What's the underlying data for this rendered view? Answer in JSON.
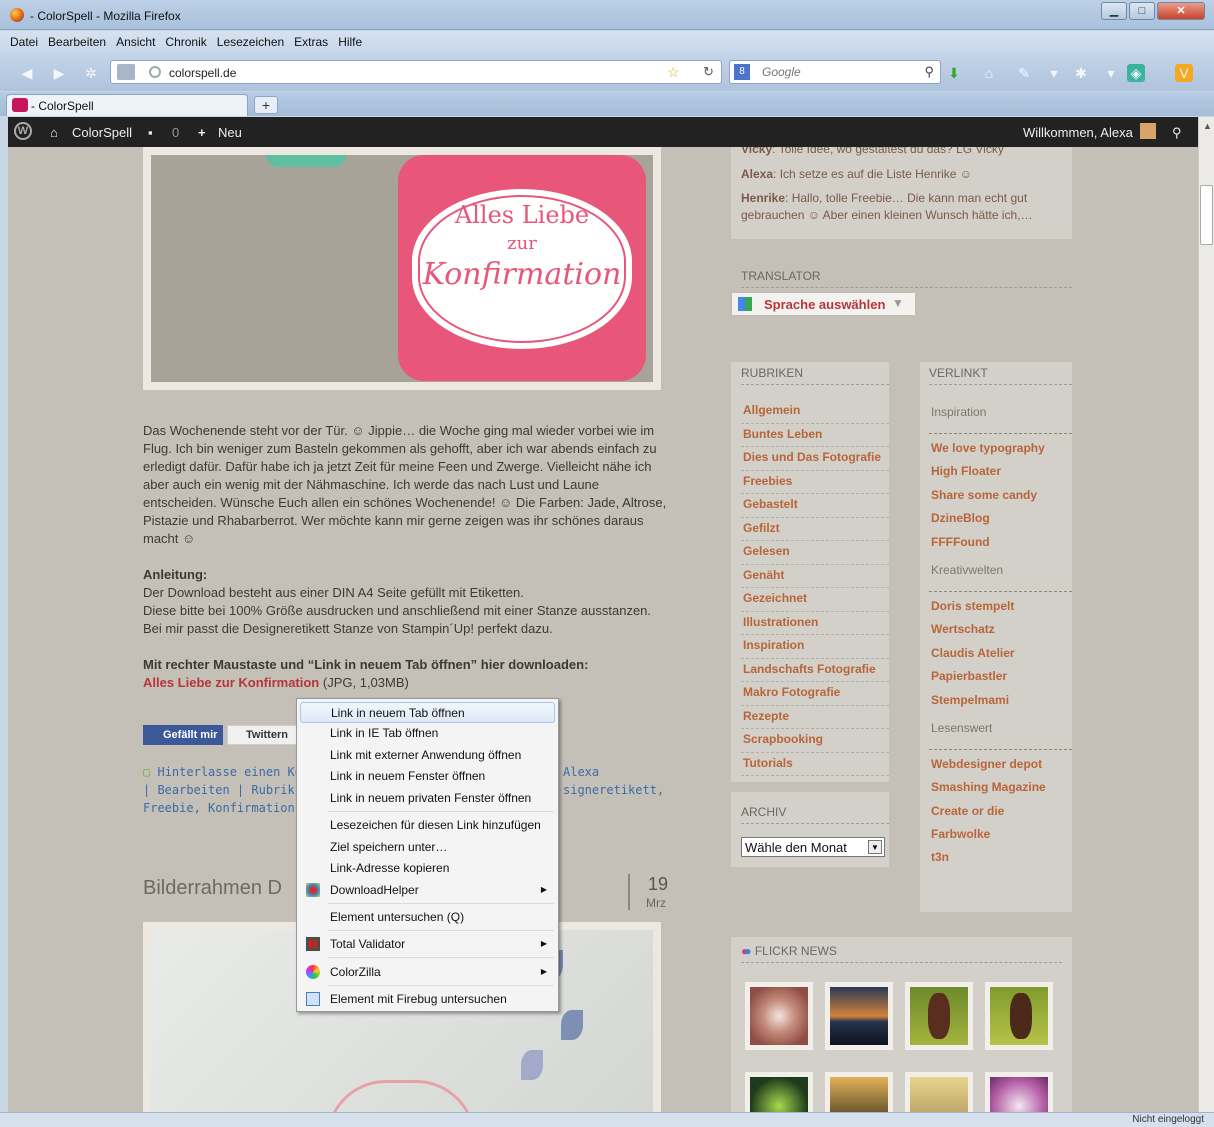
{
  "window": {
    "title": "- ColorSpell - Mozilla Firefox"
  },
  "menu": [
    "Datei",
    "Bearbeiten",
    "Ansicht",
    "Chronik",
    "Lesezeichen",
    "Extras",
    "Hilfe"
  ],
  "nav": {
    "url": "colorspell.de",
    "search_placeholder": "Google"
  },
  "tab": {
    "title": "- ColorSpell",
    "new": "+"
  },
  "admin": {
    "site": "ColorSpell",
    "comments": "0",
    "new": "Neu",
    "welcome": "Willkommen, Alexa"
  },
  "post": {
    "p1": "Das Wochenende steht vor der Tür. ☺ Jippie… die Woche ging mal wieder vorbei wie im Flug. Ich bin weniger zum Basteln gekommen als gehofft, aber ich war abends einfach zu erledigt dafür. Dafür habe ich ja jetzt Zeit für meine Feen und Zwerge. Vielleicht nähe ich aber auch ein wenig mit der Nähmaschine. Ich werde das nach Lust und Laune entscheiden. Wünsche Euch allen ein schönes Wochenende! ☺ Die Farben: Jade, Altrose, Pistazie und Rhabarberrot. Wer möchte kann mir gerne zeigen was ihr schönes daraus macht ☺",
    "anleitung_head": "Anleitung:",
    "anleitung": "Der Download besteht aus einer DIN A4 Seite gefüllt mit Etiketten.",
    "anleitung2": "Diese bitte bei 100% Größe ausdrucken und anschließend mit einer Stanze ausstanzen.",
    "anleitung3": "Bei mir passt die Designeretikett Stanze von Stampin´Up! perfekt dazu.",
    "download_head": "Mit rechter Maustaste und “Link in neuem Tab öffnen” hier downloaden:",
    "download_link": "Alles Liebe zur Konfirmation",
    "download_size": "(JPG, 1,03MB)",
    "label_line1": "Alles Liebe",
    "label_line2": "zur",
    "label_line3": "Konfirmation",
    "fb": "Gefällt mir",
    "tw": "Twittern",
    "meta1": "Hinterlasse einen Kor",
    "meta1b": "Alexa",
    "meta2": "| Bearbeiten | Rubrik: F",
    "meta2b": "signeretikett,",
    "meta3": "Freebie, Konfirmation, S",
    "next_title": "Bilderrahmen D",
    "next_day": "19",
    "next_month": "Mrz"
  },
  "recent": [
    {
      "author": "Vicky",
      "text": ": Tolle Idee, wo gestaltest du das? LG Vicky"
    },
    {
      "author": "Alexa",
      "text": ": Ich setze es auf die Liste Henrike ☺"
    },
    {
      "author": "Henrike",
      "text": ": Hallo, tolle Freebie… Die kann man echt gut gebrauchen ☺ Aber einen kleinen Wunsch hätte ich,…"
    }
  ],
  "translator": {
    "head": "TRANSLATOR",
    "label": "Sprache auswählen",
    "arrow": "▼"
  },
  "rubriken": {
    "head": "RUBRIKEN",
    "items": [
      "Allgemein",
      "Buntes Leben",
      "Dies und Das Fotografie",
      "Freebies",
      "Gebastelt",
      "Gefilzt",
      "Gelesen",
      "Genäht",
      "Gezeichnet",
      "Illustrationen",
      "Inspiration",
      "Landschafts Fotografie",
      "Makro Fotografie",
      "Rezepte",
      "Scrapbooking",
      "Tutorials"
    ]
  },
  "verlinkt": {
    "head": "VERLINKT",
    "groups": [
      {
        "title": "Inspiration",
        "items": [
          "We love typography",
          "High Floater",
          "Share some candy",
          "DzineBlog",
          "FFFFound"
        ]
      },
      {
        "title": "Kreativwelten",
        "items": [
          "Doris stempelt",
          "Wertschatz",
          "Claudis Atelier",
          "Papierbastler",
          "Stempelmami"
        ]
      },
      {
        "title": "Lesenswert",
        "items": [
          "Webdesigner depot",
          "Smashing Magazine",
          "Create or die",
          "Farbwolke",
          "t3n"
        ]
      }
    ]
  },
  "archiv": {
    "head": "ARCHIV",
    "select": "Wähle den Monat"
  },
  "flickr": {
    "head": "FLICKR NEWS"
  },
  "context_menu": [
    {
      "label": "Link in neuem Tab öffnen",
      "highlight": true
    },
    {
      "label": "Link in IE Tab öffnen"
    },
    {
      "label": "Link mit externer Anwendung öffnen"
    },
    {
      "label": "Link in neuem Fenster öffnen"
    },
    {
      "label": "Link in neuem privaten Fenster öffnen"
    },
    {
      "label": "Lesezeichen für diesen Link hinzufügen"
    },
    {
      "label": "Ziel speichern unter…"
    },
    {
      "label": "Link-Adresse kopieren"
    },
    {
      "label": "DownloadHelper"
    },
    {
      "label": "Element untersuchen (Q)"
    },
    {
      "label": "Total Validator"
    },
    {
      "label": "ColorZilla"
    },
    {
      "label": "Element mit Firebug untersuchen"
    }
  ],
  "status": {
    "right": "Nicht eingeloggt"
  }
}
